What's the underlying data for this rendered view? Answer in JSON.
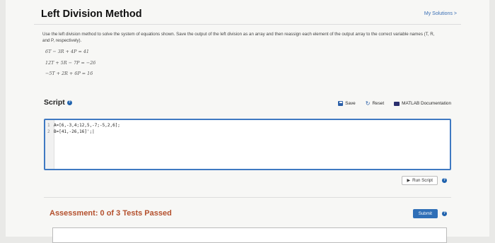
{
  "header": {
    "title": "Left Division Method",
    "my_solutions": "My Solutions >"
  },
  "problem": {
    "instructions": "Use the left division method to solve the system of equations shown. Save the output of the left division as an array and then reassign each element of the output array to the correct variable names (T, R, and P, respectively).",
    "equations": [
      "6T − 3R + 4P = 41",
      "12T + 5R − 7P = −26",
      "−5T + 2R + 6P = 16"
    ]
  },
  "script": {
    "label": "Script",
    "save_label": "Save",
    "reset_label": "Reset",
    "docs_label": "MATLAB Documentation",
    "code_lines": [
      {
        "num": "1",
        "text": "A=[6,-3,4;12,5,-7;-5,2,6];"
      },
      {
        "num": "2",
        "text": "B=[41,-26,16]';|"
      }
    ],
    "run_label": "Run Script"
  },
  "assessment": {
    "text": "Assessment: 0 of 3 Tests Passed",
    "submit_label": "Submit"
  },
  "colors": {
    "accent": "#3f79c2",
    "assessment": "#b4502d",
    "submit": "#2f6fb7"
  }
}
